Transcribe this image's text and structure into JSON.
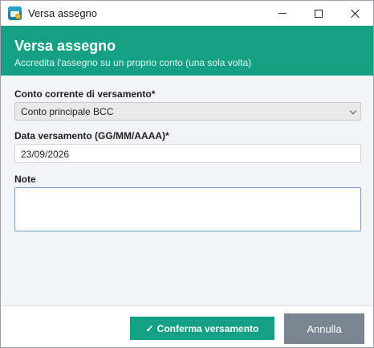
{
  "window": {
    "title": "Versa assegno",
    "icons": {
      "app": "cheque-app-icon",
      "minimize": "minimize-icon",
      "maximize": "maximize-icon",
      "close": "close-icon"
    }
  },
  "header": {
    "title": "Versa assegno",
    "subtitle": "Accredita l'assegno su un proprio conto (una sola volta)",
    "color": "#14a085"
  },
  "form": {
    "account": {
      "label": "Conto corrente di versamento*",
      "selected": "Conto principale BCC"
    },
    "date": {
      "label": "Data versamento (GG/MM/AAAA)*",
      "value": "23/09/2026"
    },
    "note": {
      "label": "Note",
      "value": ""
    }
  },
  "footer": {
    "confirm_icon": "✓",
    "confirm_label": "Conferma versamento",
    "cancel_label": "Annulla",
    "confirm_color": "#14a085",
    "cancel_color": "#7b8591"
  }
}
